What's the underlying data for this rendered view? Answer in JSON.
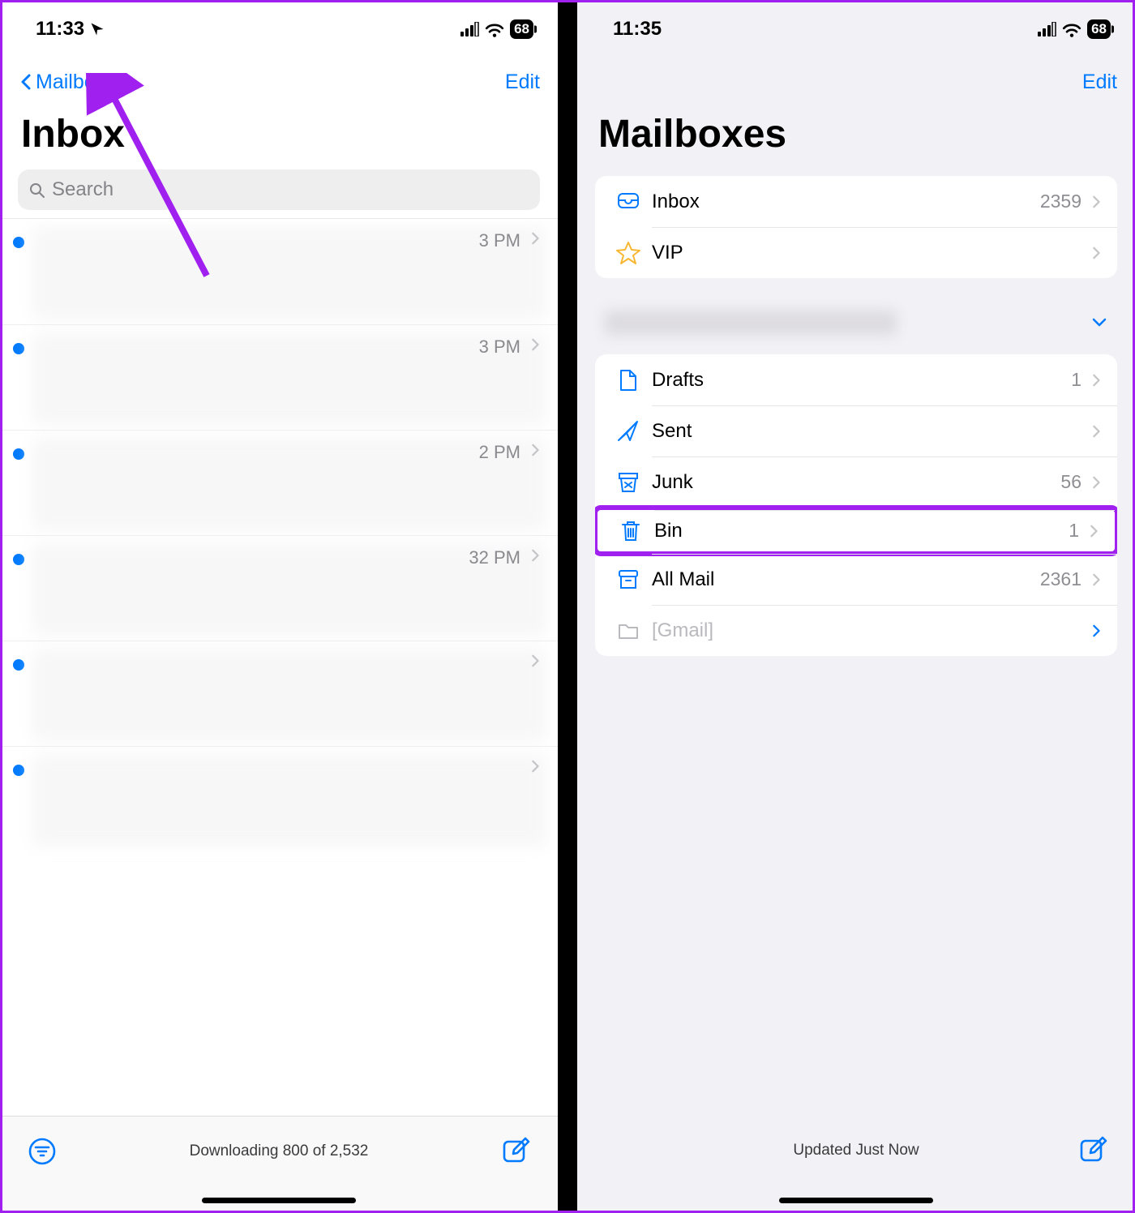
{
  "left": {
    "status": {
      "time": "11:33",
      "battery": "68"
    },
    "nav": {
      "back": "Mailboxes",
      "edit": "Edit"
    },
    "title": "Inbox",
    "search": {
      "placeholder": "Search"
    },
    "messages": [
      {
        "time": "3 PM"
      },
      {
        "time": "3 PM"
      },
      {
        "time": "2 PM"
      },
      {
        "time": "32 PM"
      },
      {
        "time": ""
      },
      {
        "time": ""
      }
    ],
    "toolbar": {
      "status": "Downloading 800 of 2,532"
    }
  },
  "right": {
    "status": {
      "time": "11:35",
      "battery": "68"
    },
    "nav": {
      "edit": "Edit"
    },
    "title": "Mailboxes",
    "top_group": [
      {
        "icon": "inbox",
        "label": "Inbox",
        "count": "2359"
      },
      {
        "icon": "star",
        "label": "VIP",
        "count": ""
      }
    ],
    "account_group": [
      {
        "icon": "doc",
        "label": "Drafts",
        "count": "1"
      },
      {
        "icon": "send",
        "label": "Sent",
        "count": ""
      },
      {
        "icon": "junk",
        "label": "Junk",
        "count": "56"
      },
      {
        "icon": "trash",
        "label": "Bin",
        "count": "1",
        "highlight": true
      },
      {
        "icon": "archive",
        "label": "All Mail",
        "count": "2361"
      },
      {
        "icon": "folder",
        "label": "[Gmail]",
        "count": "",
        "gray": true,
        "bluechev": true
      }
    ],
    "toolbar": {
      "status": "Updated Just Now"
    }
  }
}
